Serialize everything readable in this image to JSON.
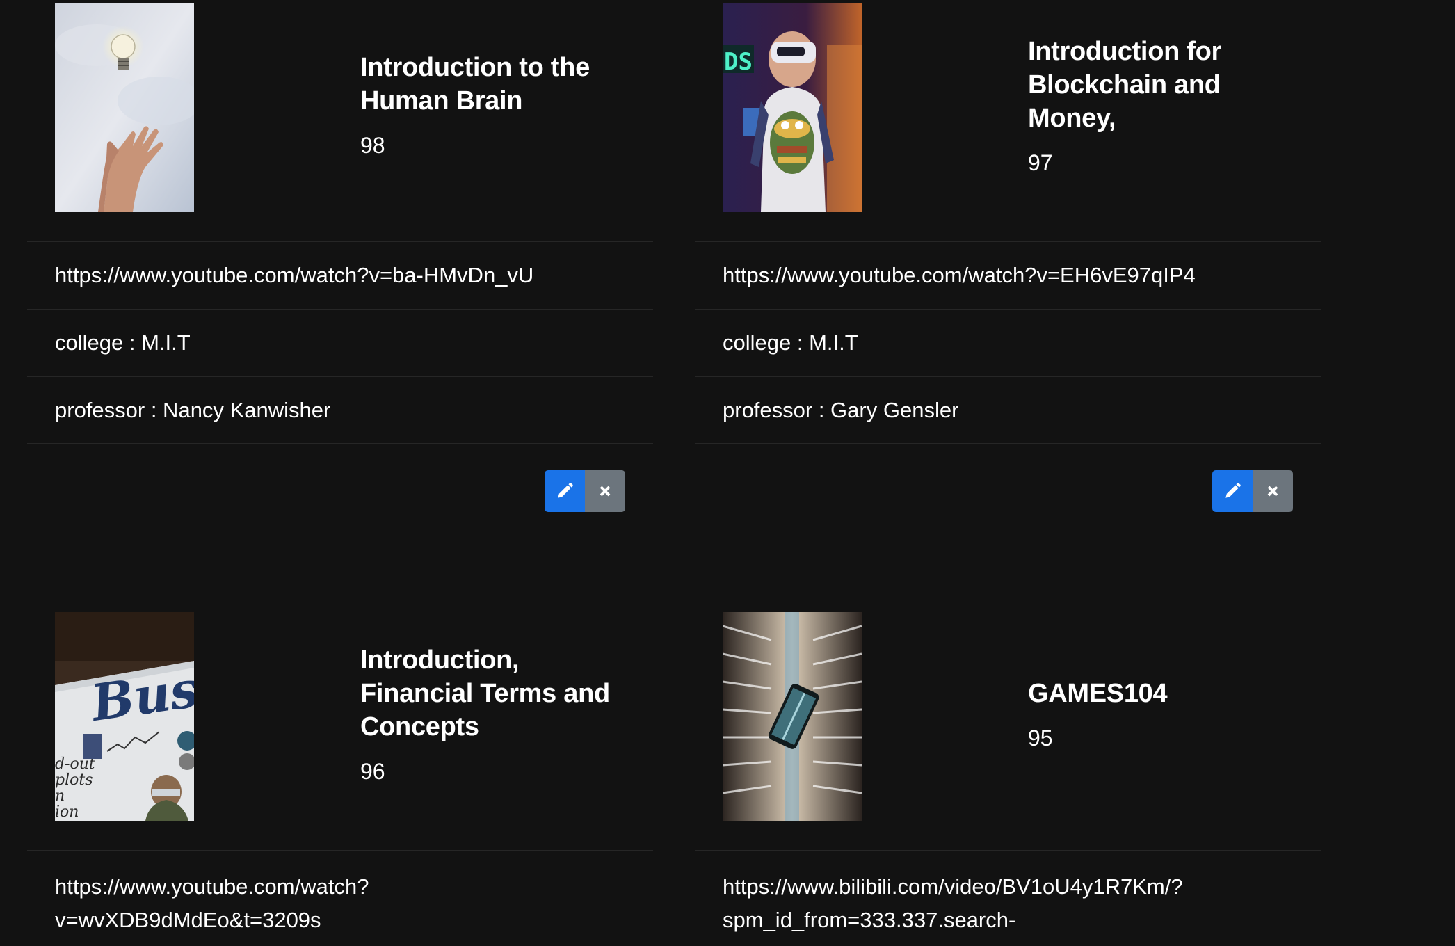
{
  "courses": [
    {
      "title": "Introduction to the Human Brain",
      "score": "98",
      "url": "https://www.youtube.com/watch?v=ba-HMvDn_vU",
      "college": "college : M.I.T",
      "professor": "professor : Nancy Kanwisher",
      "image": "lightbulb-hand"
    },
    {
      "title": "Introduction for Blockchain and Money,",
      "score": "97",
      "url": "https://www.youtube.com/watch?v=EH6vE97qIP4",
      "college": "college : M.I.T",
      "professor": "professor : Gary Gensler",
      "image": "vr-headset-person"
    },
    {
      "title": "Introduction, Financial Terms and Concepts",
      "score": "96",
      "url_lines": [
        "https://www.youtube.com/watch?",
        "v=wvXDB9dMdEo&t=3209s"
      ],
      "image": "business-newspaper"
    },
    {
      "title": "GAMES104",
      "score": "95",
      "url_lines": [
        "https://www.bilibili.com/video/BV1oU4y1R7Km/?",
        "spm_id_from=333.337.search-"
      ],
      "image": "phone-in-building"
    }
  ],
  "icons": {
    "edit": "pencil-icon",
    "delete": "close-icon"
  },
  "colors": {
    "background": "#121212",
    "edit_button": "#1a73e8",
    "delete_button": "#6c757d",
    "divider": "#262626"
  }
}
